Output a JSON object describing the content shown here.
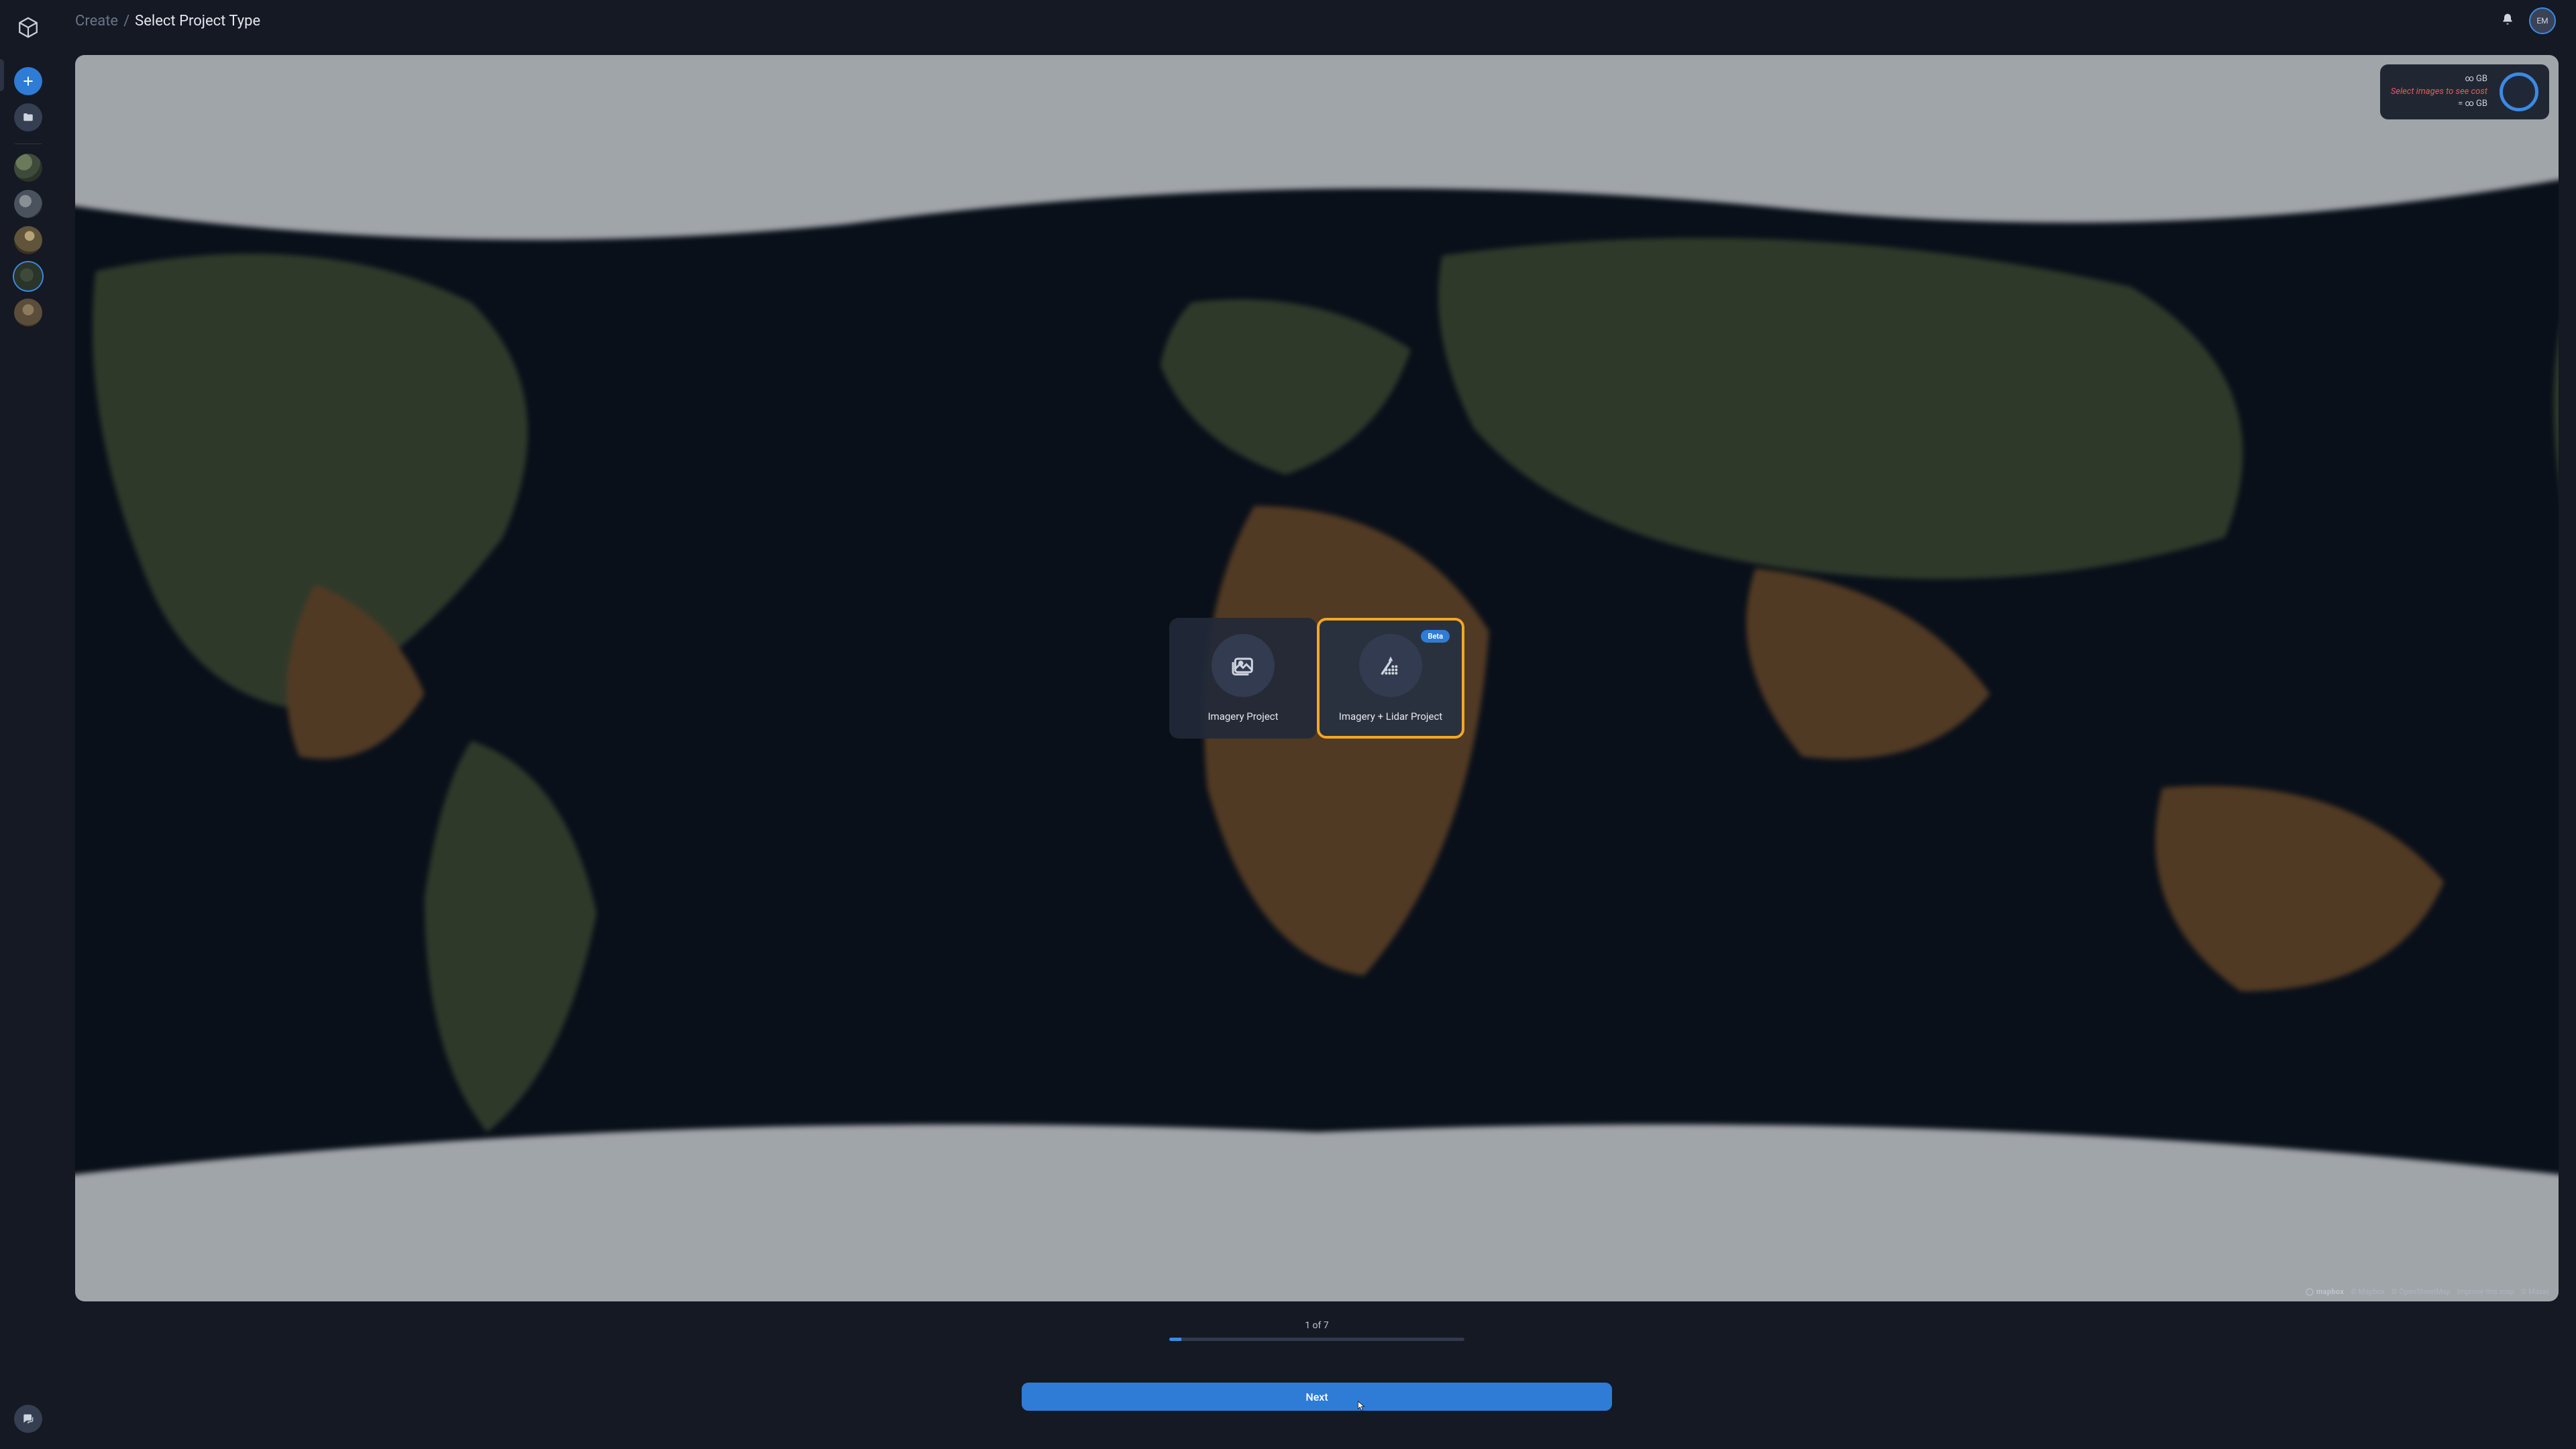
{
  "breadcrumb": {
    "root": "Create",
    "sep": " / ",
    "current": "Select Project Type"
  },
  "header": {
    "avatar_initials": "EM"
  },
  "sidebar": {
    "add_title": "Create",
    "folder_title": "Files"
  },
  "usage": {
    "line1": "∞ GB",
    "line2": "Select images to see cost",
    "line3": "= ∞ GB"
  },
  "project_types": {
    "imagery": {
      "label": "Imagery Project"
    },
    "imagery_lidar": {
      "label": "Imagery + Lidar Project",
      "badge": "Beta"
    }
  },
  "attribution": {
    "mapbox_logo": "mapbox",
    "c1": "© Mapbox",
    "c2": "© OpenStreetMap",
    "c3": "Improve this map",
    "c4": "© Maxar"
  },
  "progress": {
    "label": "1 of 7",
    "current": 1,
    "total": 7
  },
  "buttons": {
    "next": "Next"
  }
}
